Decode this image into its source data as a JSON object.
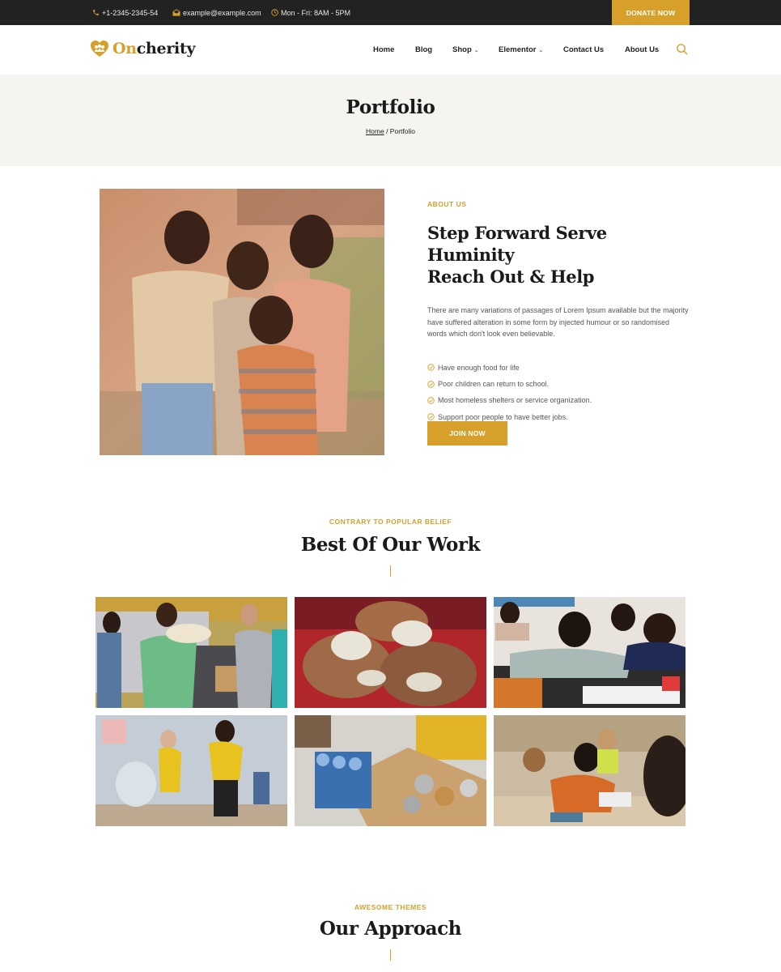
{
  "topbar": {
    "phone": "+1-2345-2345-54",
    "email": "example@example.com",
    "hours": "Mon - Fri: 8AM - 5PM",
    "donate_label": "DONATE NOW"
  },
  "header": {
    "logo": {
      "accent": "On",
      "rest": "cherity"
    },
    "nav": [
      {
        "label": "Home",
        "has_dropdown": false
      },
      {
        "label": "Blog",
        "has_dropdown": false
      },
      {
        "label": "Shop",
        "has_dropdown": true
      },
      {
        "label": "Elementor",
        "has_dropdown": true
      },
      {
        "label": "Contact Us",
        "has_dropdown": false
      },
      {
        "label": "About Us",
        "has_dropdown": false
      }
    ],
    "search_icon": "search-icon",
    "dropdown_glyph": "⌄"
  },
  "banner": {
    "title": "Portfolio",
    "breadcrumb": {
      "home": "Home",
      "separator": " / ",
      "current": "Portfolio"
    }
  },
  "about": {
    "eyebrow": "ABOUT US",
    "title_line1": "Step Forward Serve Huminity",
    "title_line2": "Reach Out & Help",
    "description": "There are many variations of passages of Lorem Ipsum available but the majority have suffered alteration in some form by injected humour or so randomised words which don't look even believable.",
    "checklist": [
      "Have enough food for life",
      "Poor children can return to school.",
      "Most homeless shelters or service organization.",
      "Support poor people to have better jobs."
    ],
    "cta_label": "JOIN NOW",
    "image": "children-group-photo"
  },
  "work": {
    "eyebrow": "CONTRARY TO POPULAR BELIEF",
    "title": "Best Of Our Work",
    "gallery": [
      "volunteers-loading-truck",
      "hands-holding-rice",
      "students-in-classroom",
      "kids-cleanup-beach",
      "food-donation-box",
      "children-at-desks"
    ]
  },
  "approach": {
    "eyebrow": "AWESOME THEMES",
    "title": "Our Approach"
  },
  "colors": {
    "accent": "#d6a02b",
    "topbar_bg": "#222222",
    "banner_bg": "#f5f4f0",
    "heading": "#1a1a1a",
    "body_text": "#555555"
  }
}
